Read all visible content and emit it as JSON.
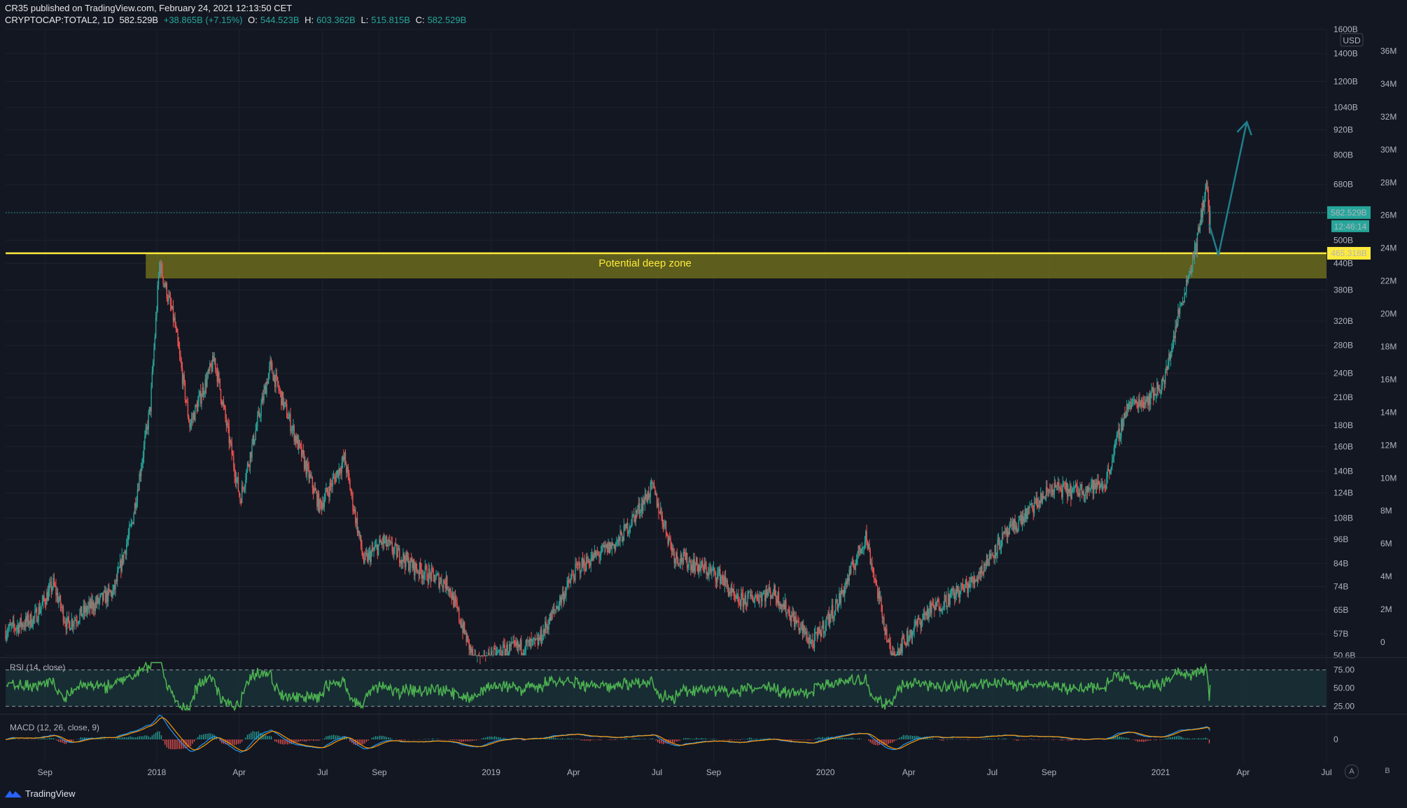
{
  "header": {
    "publisher": "CR35 published on TradingView.com, February 24, 2021 12:13:50 CET",
    "symbol": "CRYPTOCAP:TOTAL2, 1D",
    "last": "582.529B",
    "change": "+38.865B (+7.15%)",
    "o_label": "O:",
    "o_value": "544.523B",
    "h_label": "H:",
    "h_value": "603.362B",
    "l_label": "L:",
    "l_value": "515.815B",
    "c_label": "C:",
    "c_value": "582.529B"
  },
  "colors": {
    "background": "#131722",
    "up": "#26a69a",
    "down": "#ef5350",
    "zone_line": "#ffeb3b",
    "zone_fill": "#6b6a1c",
    "rsi_line": "#4caf50",
    "macd_line": "#2196f3",
    "signal_line": "#ff9800",
    "arrow": "#1e7f8c"
  },
  "footer": {
    "brand": "TradingView",
    "logo_icon": "tradingview-logo-icon"
  },
  "corners": {
    "auto": "A",
    "badge": "B"
  },
  "chart_data": [
    {
      "type": "candlestick",
      "title": "CRYPTOCAP:TOTAL2, 1D",
      "currency": "USD",
      "scale": "log",
      "ylim": [
        50.6,
        1600
      ],
      "price_ticks": [
        "1600B",
        "1400B",
        "1200B",
        "1040B",
        "920B",
        "800B",
        "680B",
        "580B",
        "500B",
        "440B",
        "380B",
        "320B",
        "280B",
        "240B",
        "210B",
        "180B",
        "160B",
        "140B",
        "124B",
        "108B",
        "96B",
        "84B",
        "74B",
        "65B",
        "57B",
        "50.6B"
      ],
      "price_tick_values": [
        1600,
        1400,
        1200,
        1040,
        920,
        800,
        680,
        580,
        500,
        440,
        380,
        320,
        280,
        240,
        210,
        180,
        160,
        140,
        124,
        108,
        96,
        84,
        74,
        65,
        57,
        50.6
      ],
      "volume_ticks": [
        "36M",
        "34M",
        "32M",
        "30M",
        "28M",
        "26M",
        "24M",
        "22M",
        "20M",
        "18M",
        "16M",
        "14M",
        "12M",
        "10M",
        "8M",
        "6M",
        "4M",
        "2M",
        "0"
      ],
      "volume_tick_values": [
        36,
        34,
        32,
        30,
        28,
        26,
        24,
        22,
        20,
        18,
        16,
        14,
        12,
        10,
        8,
        6,
        4,
        2,
        0
      ],
      "x_ticks": [
        "Sep",
        "2018",
        "Apr",
        "Jul",
        "Sep",
        "2019",
        "Apr",
        "Jul",
        "Sep",
        "2020",
        "Apr",
        "Jul",
        "Sep",
        "2021",
        "Apr",
        "Jul"
      ],
      "x_tick_dates": [
        "2017-09-01",
        "2018-01-01",
        "2018-04-01",
        "2018-07-01",
        "2018-09-01",
        "2019-01-01",
        "2019-04-01",
        "2019-07-01",
        "2019-09-01",
        "2020-01-01",
        "2020-04-01",
        "2020-07-01",
        "2020-09-01",
        "2021-01-01",
        "2021-04-01",
        "2021-07-01"
      ],
      "x_range": [
        "2017-07-20",
        "2021-07-01"
      ],
      "trend_points": [
        {
          "date": "2017-07-20",
          "value": 58
        },
        {
          "date": "2017-08-20",
          "value": 62
        },
        {
          "date": "2017-09-10",
          "value": 75
        },
        {
          "date": "2017-09-25",
          "value": 60
        },
        {
          "date": "2017-10-20",
          "value": 66
        },
        {
          "date": "2017-11-15",
          "value": 72
        },
        {
          "date": "2017-12-05",
          "value": 105
        },
        {
          "date": "2017-12-25",
          "value": 200
        },
        {
          "date": "2018-01-04",
          "value": 440
        },
        {
          "date": "2018-01-20",
          "value": 320
        },
        {
          "date": "2018-02-06",
          "value": 180
        },
        {
          "date": "2018-03-05",
          "value": 260
        },
        {
          "date": "2018-04-02",
          "value": 120
        },
        {
          "date": "2018-05-05",
          "value": 250
        },
        {
          "date": "2018-06-28",
          "value": 115
        },
        {
          "date": "2018-07-25",
          "value": 150
        },
        {
          "date": "2018-08-15",
          "value": 85
        },
        {
          "date": "2018-09-05",
          "value": 95
        },
        {
          "date": "2018-10-10",
          "value": 82
        },
        {
          "date": "2018-11-15",
          "value": 75
        },
        {
          "date": "2018-12-15",
          "value": 48
        },
        {
          "date": "2019-01-15",
          "value": 52
        },
        {
          "date": "2019-02-20",
          "value": 54
        },
        {
          "date": "2019-04-05",
          "value": 82
        },
        {
          "date": "2019-05-20",
          "value": 95
        },
        {
          "date": "2019-06-26",
          "value": 128
        },
        {
          "date": "2019-07-20",
          "value": 88
        },
        {
          "date": "2019-09-10",
          "value": 78
        },
        {
          "date": "2019-09-25",
          "value": 68
        },
        {
          "date": "2019-11-05",
          "value": 72
        },
        {
          "date": "2019-12-18",
          "value": 54
        },
        {
          "date": "2020-01-15",
          "value": 68
        },
        {
          "date": "2020-02-14",
          "value": 98
        },
        {
          "date": "2020-03-13",
          "value": 50
        },
        {
          "date": "2020-04-20",
          "value": 64
        },
        {
          "date": "2020-06-10",
          "value": 76
        },
        {
          "date": "2020-07-10",
          "value": 95
        },
        {
          "date": "2020-08-15",
          "value": 115
        },
        {
          "date": "2020-09-05",
          "value": 128
        },
        {
          "date": "2020-09-25",
          "value": 125
        },
        {
          "date": "2020-11-01",
          "value": 130
        },
        {
          "date": "2020-11-25",
          "value": 200
        },
        {
          "date": "2020-12-20",
          "value": 210
        },
        {
          "date": "2021-01-05",
          "value": 230
        },
        {
          "date": "2021-01-20",
          "value": 330
        },
        {
          "date": "2021-02-10",
          "value": 500
        },
        {
          "date": "2021-02-20",
          "value": 690
        },
        {
          "date": "2021-02-23",
          "value": 545
        },
        {
          "date": "2021-02-24",
          "value": 582.529
        }
      ],
      "last_price_label": "582.529B",
      "countdown_label": "12:46:14",
      "zone_level_label": "465.318B",
      "zone_level": 465.318,
      "zone_bottom": 405,
      "zone_start": "2017-12-20",
      "zone_text": "Potential deep zone",
      "projection_arrow": [
        {
          "date": "2021-02-23",
          "value": 545
        },
        {
          "date": "2021-03-05",
          "value": 460
        },
        {
          "date": "2021-04-05",
          "value": 960
        }
      ]
    },
    {
      "type": "line",
      "title": "RSI (14, close)",
      "ylim": [
        15,
        90
      ],
      "levels": [
        75.0,
        50.0,
        25.0
      ],
      "level_labels": [
        "75.00",
        "50.00",
        "25.00"
      ]
    },
    {
      "type": "histogram",
      "title": "MACD (12, 26, close, 9)",
      "zero_label": "0"
    }
  ]
}
